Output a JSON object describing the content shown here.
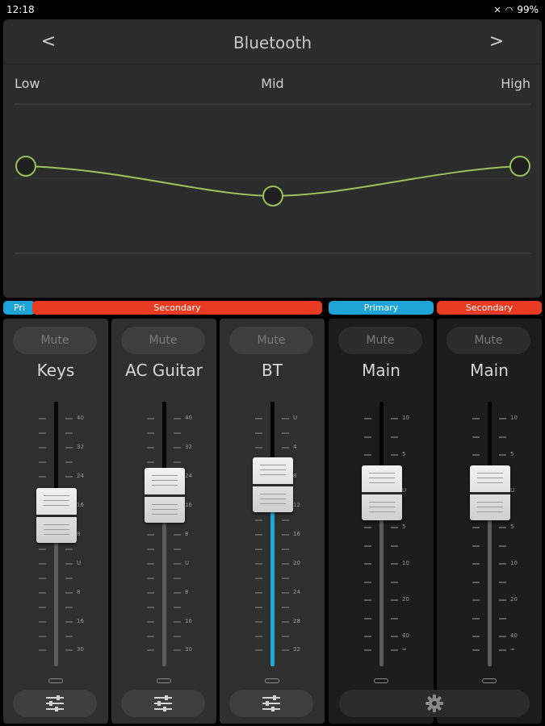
{
  "status_bar": {
    "time": "12:18",
    "battery": "99%"
  },
  "eq": {
    "title": "Bluetooth",
    "prev_label": "<",
    "next_label": ">",
    "band_low": "Low",
    "band_mid": "Mid",
    "band_high": "High",
    "curve_color": "#9ac25a"
  },
  "routing": {
    "pri_small": "Pri",
    "secondary_wide": "Secondary",
    "primary_main": "Primary",
    "secondary_main": "Secondary",
    "primary_color": "#1ea3d6",
    "secondary_color": "#ea3a22"
  },
  "channels": [
    {
      "mute_label": "Mute",
      "name": "Keys",
      "scale": [
        "40",
        "32",
        "24",
        "16",
        "8",
        "U",
        "8",
        "16",
        "30"
      ]
    },
    {
      "mute_label": "Mute",
      "name": "AC Guitar",
      "scale": [
        "40",
        "32",
        "24",
        "16",
        "8",
        "U",
        "8",
        "16",
        "30"
      ]
    },
    {
      "mute_label": "Mute",
      "name": "BT",
      "scale": [
        "U",
        "4",
        "8",
        "12",
        "16",
        "20",
        "24",
        "28",
        "32"
      ]
    },
    {
      "mute_label": "Mute",
      "name": "Main",
      "scale": [
        "10",
        "5",
        "U",
        "5",
        "10",
        "20",
        "40",
        "∞"
      ]
    },
    {
      "mute_label": "Mute",
      "name": "Main",
      "scale": [
        "10",
        "5",
        "U",
        "5",
        "10",
        "20",
        "40",
        "∞"
      ]
    }
  ],
  "icons": {
    "sliders": "sliders-icon",
    "settings": "gear-icon"
  }
}
